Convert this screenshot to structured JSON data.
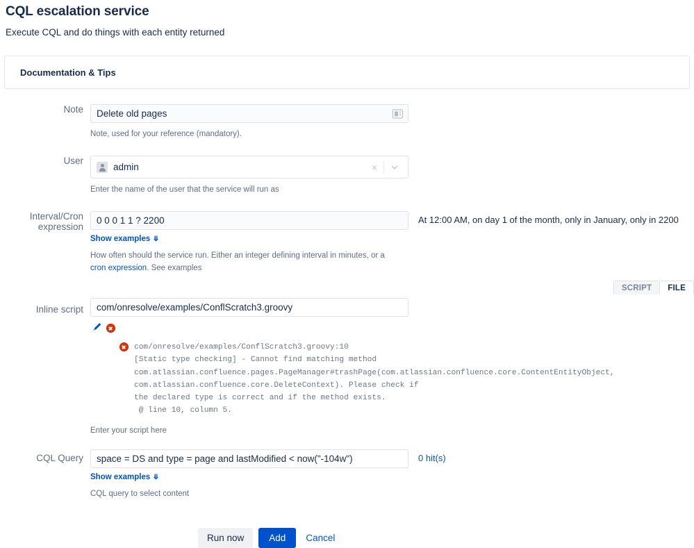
{
  "header": {
    "title": "CQL escalation service",
    "subtitle": "Execute CQL and do things with each entity returned"
  },
  "doc_panel": {
    "title": "Documentation & Tips"
  },
  "form": {
    "note": {
      "label": "Note",
      "value": "Delete old pages",
      "description": "Note, used for your reference (mandatory).",
      "icon": "contact-card-icon"
    },
    "user": {
      "label": "User",
      "value": "admin",
      "description": "Enter the name of the user that the service will run as",
      "clear_icon": "close-icon",
      "dropdown_icon": "chevron-down-icon",
      "avatar_icon": "user-avatar-icon"
    },
    "cron": {
      "label": "Interval/Cron expression",
      "value": "0 0 0 1 1 ? 2200",
      "human_readable": "At 12:00 AM, on day 1 of the month, only in January, only in 2200",
      "show_examples": "Show examples",
      "description_part1": "How often should the service run. Either an integer defining interval in minutes, or a ",
      "description_link": "cron expression",
      "description_part2": ". See examples"
    },
    "script": {
      "label": "Inline script",
      "value": "com/onresolve/examples/ConflScratch3.groovy",
      "description": "Enter your script here",
      "tabs": [
        {
          "label": "SCRIPT",
          "active": false
        },
        {
          "label": "FILE",
          "active": true
        }
      ],
      "edit_icon": "pencil-icon",
      "delete_icon": "delete-circle-icon",
      "error": {
        "icon": "error-icon",
        "lines": [
          "com/onresolve/examples/ConflScratch3.groovy:10",
          "[Static type checking] - Cannot find matching method",
          "com.atlassian.confluence.pages.PageManager#trashPage(com.atlassian.confluence.core.ContentEntityObject,",
          "com.atlassian.confluence.core.DeleteContext). Please check if",
          "the declared type is correct and if the method exists.",
          " @ line 10, column 5."
        ]
      }
    },
    "cql": {
      "label": "CQL Query",
      "value": "space = DS and type = page and lastModified < now(\"-104w\")",
      "hits": "0 hit(s)",
      "show_examples": "Show examples",
      "description": "CQL query to select content"
    }
  },
  "buttons": {
    "run_now": "Run now",
    "add": "Add",
    "cancel": "Cancel"
  },
  "colors": {
    "accent": "#0052CC",
    "error": "#DE350B",
    "text": "#172B4D",
    "muted": "#5E6C84"
  }
}
